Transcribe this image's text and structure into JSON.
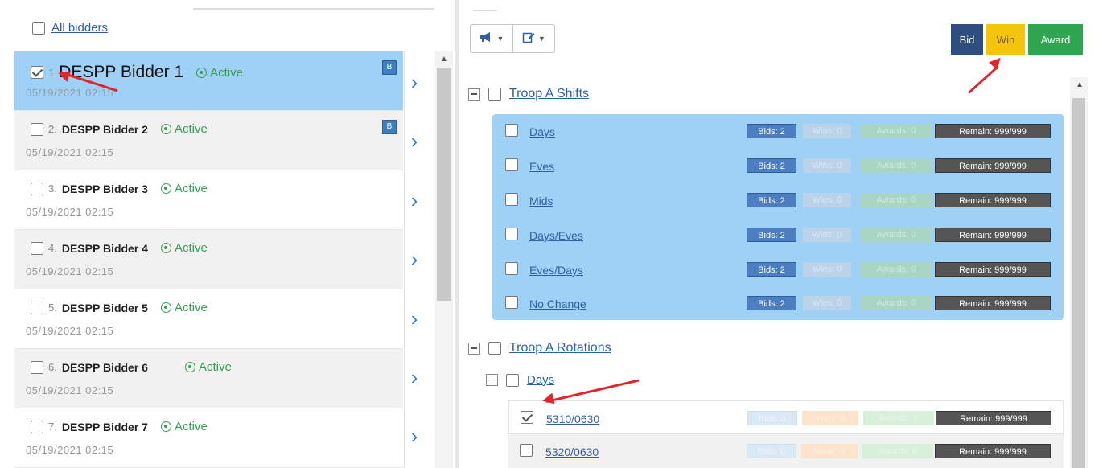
{
  "left_panel": {
    "all_bidders_label": "All bidders",
    "bidders": [
      {
        "num": "1",
        "name": "DESPP Bidder 1",
        "status": "Active",
        "date": "05/19/2021 02:15",
        "checked": true,
        "badge": "B"
      },
      {
        "num": "2.",
        "name": "DESPP Bidder 2",
        "status": "Active",
        "date": "05/19/2021 02:15",
        "checked": false,
        "badge": "B"
      },
      {
        "num": "3.",
        "name": "DESPP Bidder 3",
        "status": "Active",
        "date": "05/19/2021 02:15",
        "checked": false
      },
      {
        "num": "4.",
        "name": "DESPP Bidder 4",
        "status": "Active",
        "date": "05/19/2021 02:15",
        "checked": false
      },
      {
        "num": "5.",
        "name": "DESPP Bidder 5",
        "status": "Active",
        "date": "05/19/2021 02:15",
        "checked": false
      },
      {
        "num": "6.",
        "name": "DESPP Bidder 6",
        "status": "Active",
        "date": "05/19/2021 02:15",
        "checked": false
      },
      {
        "num": "7.",
        "name": "DESPP Bidder 7",
        "status": "Active",
        "date": "05/19/2021 02:15",
        "checked": false
      }
    ]
  },
  "toolbar": {
    "megaphone_icon": "megaphone-icon",
    "edit_icon": "edit-icon"
  },
  "actions": {
    "bid_label": "Bid",
    "win_label": "Win",
    "award_label": "Award",
    "colors": {
      "bid": "#2e4d80",
      "win": "#f5c40c",
      "award": "#2ea64f"
    }
  },
  "tree": {
    "group1": {
      "label": "Troop A Shifts",
      "items": [
        {
          "label": "Days",
          "bids": "Bids: 2",
          "wins": "Wins: 0",
          "awards": "Awards: 0",
          "remain": "Remain: 999/999"
        },
        {
          "label": "Eves",
          "bids": "Bids: 2",
          "wins": "Wins: 0",
          "awards": "Awards: 0",
          "remain": "Remain: 999/999"
        },
        {
          "label": "Mids",
          "bids": "Bids: 2",
          "wins": "Wins: 0",
          "awards": "Awards: 0",
          "remain": "Remain: 999/999"
        },
        {
          "label": "Days/Eves",
          "bids": "Bids: 2",
          "wins": "Wins: 0",
          "awards": "Awards: 0",
          "remain": "Remain: 999/999"
        },
        {
          "label": "Eves/Days",
          "bids": "Bids: 2",
          "wins": "Wins: 0",
          "awards": "Awards: 0",
          "remain": "Remain: 999/999"
        },
        {
          "label": "No Change",
          "bids": "Bids: 2",
          "wins": "Wins: 0",
          "awards": "Awards: 0",
          "remain": "Remain: 999/999"
        }
      ]
    },
    "group2": {
      "label": "Troop A Rotations",
      "subgroup": {
        "label": "Days",
        "items": [
          {
            "label": "5310/0630",
            "bids": "Bids: 0",
            "wins": "Wins: 0",
            "awards": "Awards: 0",
            "remain": "Remain: 999/999",
            "checked": true
          },
          {
            "label": "5320/0630",
            "bids": "Bids: 0",
            "wins": "Wins: 0",
            "awards": "Awards: 0",
            "remain": "Remain: 999/999",
            "checked": false
          }
        ]
      }
    }
  }
}
